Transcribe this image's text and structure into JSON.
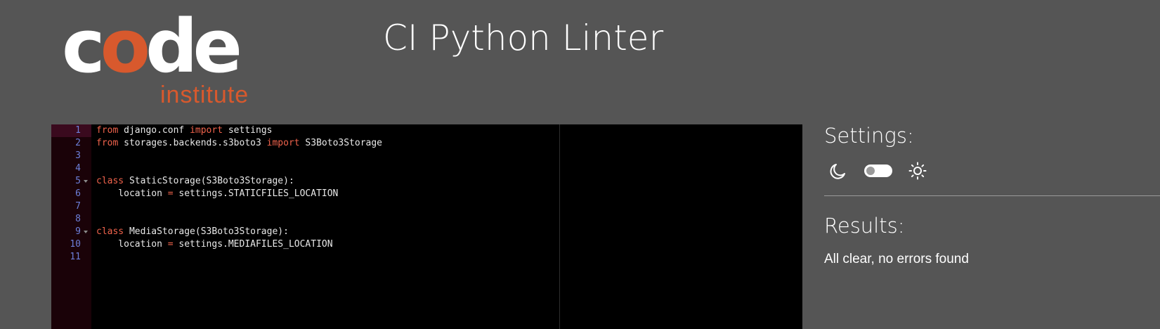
{
  "logo": {
    "word_before": "c",
    "word_accent": "o",
    "word_after": "de",
    "subtitle": "institute",
    "colors": {
      "primary": "#ffffff",
      "accent": "#d8592d"
    }
  },
  "header": {
    "title": "CI Python Linter"
  },
  "editor": {
    "active_line": 1,
    "lines": [
      {
        "number": "1",
        "tokens": [
          {
            "t": "kw",
            "v": "from"
          },
          {
            "t": "tx",
            "v": " django.conf "
          },
          {
            "t": "kw",
            "v": "import"
          },
          {
            "t": "tx",
            "v": " settings"
          }
        ]
      },
      {
        "number": "2",
        "tokens": [
          {
            "t": "kw",
            "v": "from"
          },
          {
            "t": "tx",
            "v": " storages.backends.s3boto3 "
          },
          {
            "t": "kw",
            "v": "import"
          },
          {
            "t": "tx",
            "v": " S3Boto3Storage"
          }
        ]
      },
      {
        "number": "3",
        "tokens": []
      },
      {
        "number": "4",
        "tokens": []
      },
      {
        "number": "5",
        "fold": true,
        "tokens": [
          {
            "t": "kw",
            "v": "class"
          },
          {
            "t": "tx",
            "v": " StaticStorage(S3Boto3Storage):"
          }
        ]
      },
      {
        "number": "6",
        "tokens": [
          {
            "t": "tx",
            "v": "    location "
          },
          {
            "t": "op",
            "v": "="
          },
          {
            "t": "tx",
            "v": " settings.STATICFILES_LOCATION"
          }
        ]
      },
      {
        "number": "7",
        "tokens": []
      },
      {
        "number": "8",
        "tokens": []
      },
      {
        "number": "9",
        "fold": true,
        "tokens": [
          {
            "t": "kw",
            "v": "class"
          },
          {
            "t": "tx",
            "v": " MediaStorage(S3Boto3Storage):"
          }
        ]
      },
      {
        "number": "10",
        "tokens": [
          {
            "t": "tx",
            "v": "    location "
          },
          {
            "t": "op",
            "v": "="
          },
          {
            "t": "tx",
            "v": " settings.MEDIAFILES_LOCATION"
          }
        ]
      },
      {
        "number": "11",
        "tokens": []
      }
    ],
    "colors": {
      "background": "#000000",
      "gutter": "#1a0208",
      "line_number": "#6d7fd9",
      "keyword": "#f0634c",
      "text": "#e8e8e8"
    }
  },
  "settings": {
    "title": "Settings:",
    "theme_toggle": {
      "left_icon": "moon-icon",
      "right_icon": "sun-icon",
      "state": "off"
    }
  },
  "results": {
    "title": "Results:",
    "message": "All clear, no errors found"
  },
  "page": {
    "background": "#555555"
  }
}
